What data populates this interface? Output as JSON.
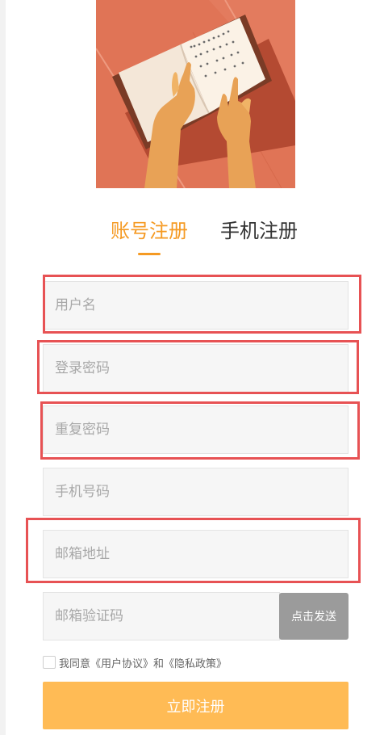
{
  "tabs": {
    "account": "账号注册",
    "phone": "手机注册"
  },
  "form": {
    "username_placeholder": "用户名",
    "password_placeholder": "登录密码",
    "confirm_password_placeholder": "重复密码",
    "phone_placeholder": "手机号码",
    "email_placeholder": "邮箱地址",
    "email_code_placeholder": "邮箱验证码",
    "send_code_label": "点击发送"
  },
  "agreement": {
    "text": "我同意《用户协议》和《隐私政策》"
  },
  "submit_label": "立即注册",
  "colors": {
    "accent": "#f59a23",
    "submit": "#ffbb55",
    "highlight": "#e75254",
    "send_button": "#9b9b9b"
  }
}
